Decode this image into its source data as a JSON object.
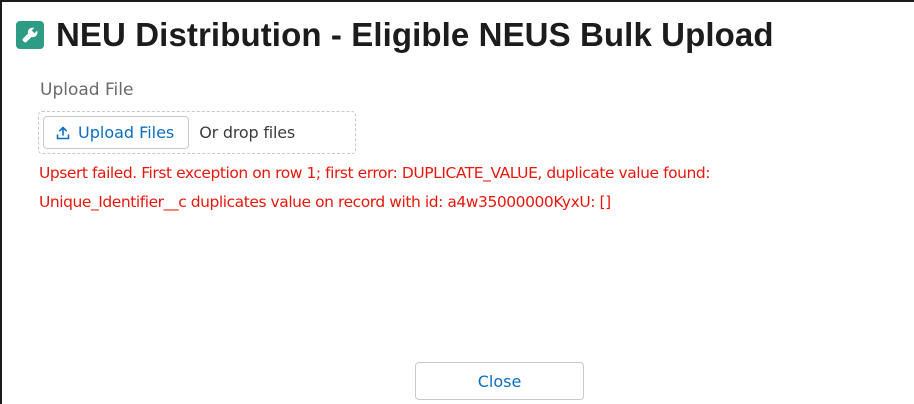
{
  "header": {
    "title": "NEU Distribution - Eligible NEUS Bulk Upload",
    "icon": "wrench-icon",
    "icon_color": "#2e9b84"
  },
  "upload": {
    "label": "Upload File",
    "button_label": "Upload Files",
    "button_icon": "upload-icon",
    "drop_text": "Or drop files"
  },
  "error": {
    "line1": "Upsert failed. First exception on row 1; first error: DUPLICATE_VALUE, duplicate value found:",
    "line2": "Unique_Identifier__c duplicates value on record with id: a4w35000000KyxU: []",
    "color": "#e8180d"
  },
  "footer": {
    "close_label": "Close"
  },
  "colors": {
    "link": "#0b6fc1"
  }
}
